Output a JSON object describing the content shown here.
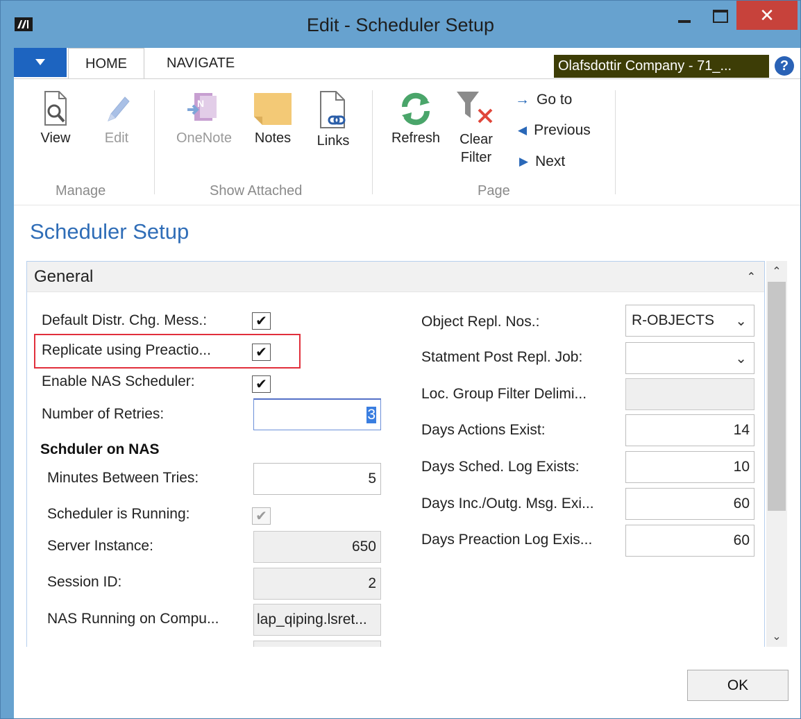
{
  "window": {
    "title": "Edit - Scheduler Setup",
    "close_glyph": "✕"
  },
  "tabs": {
    "home": "HOME",
    "navigate": "NAVIGATE",
    "company": "Olafsdottir Company - 71_...",
    "help_glyph": "?"
  },
  "ribbon": {
    "manage": {
      "label": "Manage",
      "view": "View",
      "edit": "Edit"
    },
    "show_attached": {
      "label": "Show Attached",
      "onenote": "OneNote",
      "notes": "Notes",
      "links": "Links"
    },
    "page": {
      "label": "Page",
      "refresh": "Refresh",
      "clear_filter_1": "Clear",
      "clear_filter_2": "Filter",
      "go_to": "Go to",
      "previous": "Previous",
      "next": "Next"
    }
  },
  "page_title": "Scheduler Setup",
  "general": {
    "title": "General",
    "left": {
      "default_distr_label": "Default Distr. Chg. Mess.:",
      "default_distr_checked": true,
      "replicate_label": "Replicate using Preactio...",
      "replicate_checked": true,
      "enable_nas_label": "Enable NAS Scheduler:",
      "enable_nas_checked": true,
      "retries_label": "Number of Retries:",
      "retries_value": "3",
      "section_nas": "Schduler on NAS",
      "minutes_label": "Minutes Between Tries:",
      "minutes_value": "5",
      "running_label": "Scheduler is Running:",
      "running_checked": true,
      "server_label": "Server Instance:",
      "server_value": "650",
      "session_label": "Session ID:",
      "session_value": "2",
      "nas_computer_label": "NAS Running on Compu...",
      "nas_computer_value": "lap_qiping.lsret..."
    },
    "right": {
      "object_repl_label": "Object Repl. Nos.:",
      "object_repl_value": "R-OBJECTS",
      "stmt_post_label": "Statment Post Repl. Job:",
      "stmt_post_value": "",
      "loc_group_label": "Loc. Group Filter Delimi...",
      "loc_group_value": "",
      "days_actions_label": "Days Actions Exist:",
      "days_actions_value": "14",
      "days_sched_label": "Days Sched. Log Exists:",
      "days_sched_value": "10",
      "days_inc_label": "Days Inc./Outg. Msg. Exi...",
      "days_inc_value": "60",
      "days_preaction_label": "Days Preaction Log Exis...",
      "days_preaction_value": "60"
    }
  },
  "ok_label": "OK",
  "icons": {
    "check": "✔",
    "chevron_down": "⌄",
    "chevron_up": "⌃",
    "arrow_right": "→",
    "triangle_left": "◀",
    "triangle_right": "▶"
  },
  "colors": {
    "titlebar": "#67a2cf",
    "accent_blue": "#2f6db7",
    "app_menu": "#1d64c0",
    "close": "#c7423b",
    "company_bg": "#3d3d06",
    "highlight": "#e12f3b"
  }
}
